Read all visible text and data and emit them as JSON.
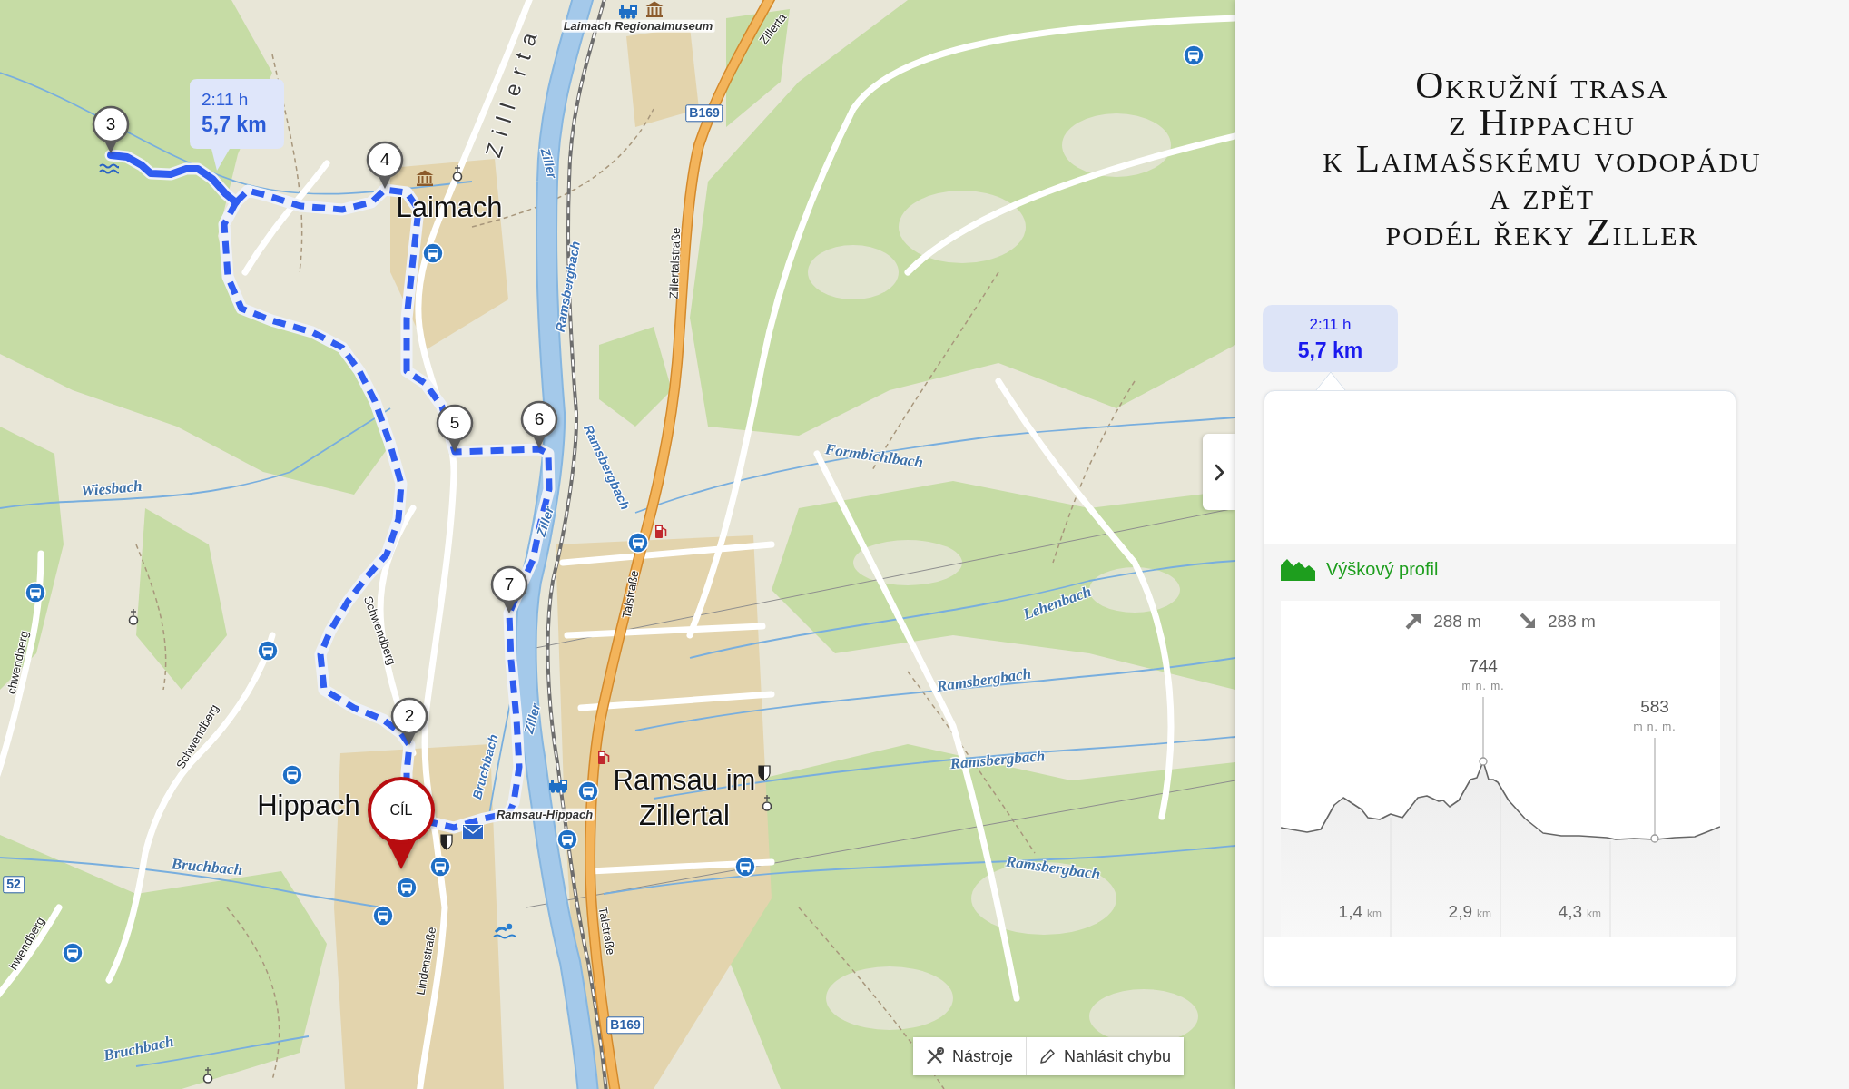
{
  "map": {
    "labels": [
      {
        "text": "Laimach Regionalmuseum",
        "kind": "poi"
      },
      {
        "text": "Zillerta",
        "kind": "road"
      },
      {
        "text": "Zillerta",
        "kind": "valley"
      },
      {
        "text": "B169",
        "kind": "road_number"
      },
      {
        "text": "Ziller",
        "kind": "river"
      },
      {
        "text": "Ramsbergbach",
        "kind": "river"
      },
      {
        "text": "Zillertalstraße",
        "kind": "road"
      },
      {
        "text": "Laimach",
        "kind": "place"
      },
      {
        "text": "Ramsbergbach",
        "kind": "river"
      },
      {
        "text": "Ziller",
        "kind": "river"
      },
      {
        "text": "Formbichlbach",
        "kind": "stream"
      },
      {
        "text": "Wiesbach",
        "kind": "stream"
      },
      {
        "text": "Lehenbach",
        "kind": "stream"
      },
      {
        "text": "Talstraße",
        "kind": "road"
      },
      {
        "text": "Schwendberg",
        "kind": "road"
      },
      {
        "text": "Ramsbergbach",
        "kind": "stream"
      },
      {
        "text": "Schwendberg",
        "kind": "road"
      },
      {
        "text": "chwendberg",
        "kind": "road"
      },
      {
        "text": "Ziller",
        "kind": "river"
      },
      {
        "text": "Bruchbach",
        "kind": "river"
      },
      {
        "text": "Ramsbergbach",
        "kind": "stream"
      },
      {
        "text": "Hippach",
        "kind": "place"
      },
      {
        "text": "Ramsau im",
        "kind": "place"
      },
      {
        "text": "Ramsau-Hippach",
        "kind": "poi"
      },
      {
        "text": "Zillertal",
        "kind": "place"
      },
      {
        "text": "Bruchbach",
        "kind": "stream"
      },
      {
        "text": "52",
        "kind": "road_number"
      },
      {
        "text": "Ramsbergbach",
        "kind": "stream"
      },
      {
        "text": "Lindenstraße",
        "kind": "road"
      },
      {
        "text": "Talstraße",
        "kind": "road"
      },
      {
        "text": "hwendberg",
        "kind": "road"
      },
      {
        "text": "B169",
        "kind": "road_number"
      },
      {
        "text": "Bruchbach",
        "kind": "stream"
      }
    ],
    "markers": [
      {
        "label": "3",
        "kind": "waypoint"
      },
      {
        "label": "4",
        "kind": "waypoint"
      },
      {
        "label": "5",
        "kind": "waypoint"
      },
      {
        "label": "6",
        "kind": "waypoint"
      },
      {
        "label": "7",
        "kind": "waypoint"
      },
      {
        "label": "2",
        "kind": "waypoint"
      },
      {
        "label": "CÍL",
        "kind": "finish"
      }
    ],
    "route_bubble": {
      "time": "2:11 h",
      "distance": "5,7 km"
    },
    "toolbar": {
      "buttons": [
        {
          "label": "Nástroje",
          "kind": "tools"
        },
        {
          "label": "Nahlásit chybu",
          "kind": "report"
        }
      ]
    }
  },
  "panel": {
    "title_lines": [
      "Okružní trasa",
      "z Hippachu",
      "k Laimašskému vodopádu",
      "a zpět",
      "podél řeky Ziller"
    ],
    "route_summary": {
      "time": "2:11 h",
      "distance": "5,7 km"
    },
    "elevation_profile": {
      "title": "Výškový profil",
      "ascent": "288 m",
      "descent": "288 m",
      "peaks": [
        {
          "value": "744",
          "unit": "m n. m."
        },
        {
          "value": "583",
          "unit": "m n. m."
        }
      ],
      "distances": [
        {
          "value": "1,4",
          "unit": "km"
        },
        {
          "value": "2,9",
          "unit": "km"
        },
        {
          "value": "4,3",
          "unit": "km"
        }
      ]
    }
  }
}
